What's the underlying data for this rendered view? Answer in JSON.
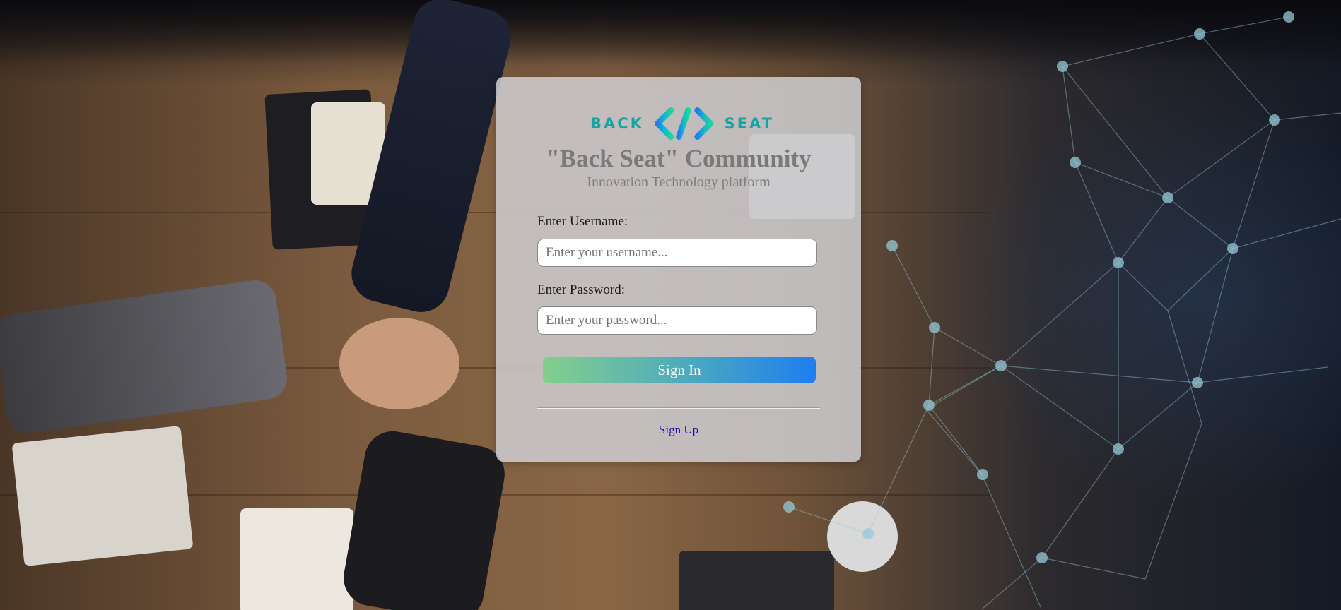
{
  "brand": {
    "logo_left": "BACK",
    "logo_right": "SEAT",
    "title": "\"Back Seat\" Community",
    "subtitle": "Innovation Technology platform"
  },
  "form": {
    "username_label": "Enter Username:",
    "username_placeholder": "Enter your username...",
    "username_value": "",
    "password_label": "Enter Password:",
    "password_placeholder": "Enter your password...",
    "password_value": "",
    "signin_label": "Sign In",
    "signup_label": "Sign Up"
  },
  "colors": {
    "logo_teal": "#19a2a2",
    "button_gradient_start": "#84cf8c",
    "button_gradient_end": "#1e7ef0",
    "link": "#1a0dab"
  }
}
